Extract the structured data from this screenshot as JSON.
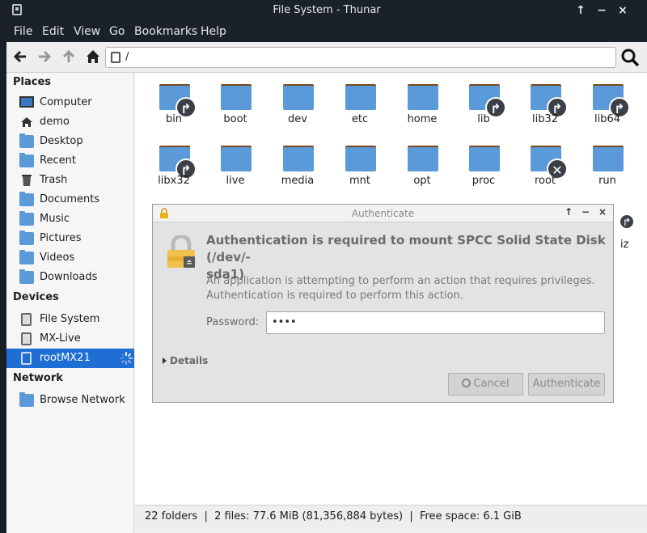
{
  "window": {
    "title": "File System - Thunar"
  },
  "titlebar_buttons": {
    "up": "↑",
    "minimize": "−",
    "close": "×"
  },
  "menu": [
    "File",
    "Edit",
    "View",
    "Go",
    "Bookmarks",
    "Help"
  ],
  "location": {
    "path": "/"
  },
  "sidebar": {
    "places_title": "Places",
    "places": [
      "Computer",
      "demo",
      "Desktop",
      "Recent",
      "Trash",
      "Documents",
      "Music",
      "Pictures",
      "Videos",
      "Downloads"
    ],
    "devices_title": "Devices",
    "devices": [
      "File System",
      "MX-Live",
      "rootMX21"
    ],
    "selected_device": "rootMX21",
    "network_title": "Network",
    "network": [
      "Browse Network"
    ]
  },
  "files": [
    {
      "name": "bin",
      "emblem": "link"
    },
    {
      "name": "boot",
      "emblem": ""
    },
    {
      "name": "dev",
      "emblem": ""
    },
    {
      "name": "etc",
      "emblem": ""
    },
    {
      "name": "home",
      "emblem": ""
    },
    {
      "name": "lib",
      "emblem": "link"
    },
    {
      "name": "lib32",
      "emblem": "link"
    },
    {
      "name": "lib64",
      "emblem": "link"
    },
    {
      "name": "libx32",
      "emblem": "link"
    },
    {
      "name": "live",
      "emblem": ""
    },
    {
      "name": "media",
      "emblem": ""
    },
    {
      "name": "mnt",
      "emblem": ""
    },
    {
      "name": "opt",
      "emblem": ""
    },
    {
      "name": "proc",
      "emblem": ""
    },
    {
      "name": "root",
      "emblem": "unreadable"
    },
    {
      "name": "run",
      "emblem": ""
    }
  ],
  "partial_label": "iz",
  "statusbar": {
    "text": "22 folders  |  2 files: 77.6 MiB (81,356,884 bytes)  |  Free space: 6.1 GiB"
  },
  "dialog": {
    "title": "Authenticate",
    "heading": "Authentication is required to mount SPCC Solid State Disk (/dev/-sda1)",
    "heading_line1": "Authentication is required to mount SPCC Solid State Disk (/dev/-",
    "heading_line2": "sda1)",
    "message_line1": "An application is attempting to perform an action that requires privileges.",
    "message_line2": "Authentication is required to perform this action.",
    "password_label": "Password:",
    "password_value": "••••",
    "details_label": "Details",
    "cancel_label": "Cancel",
    "authenticate_label": "Authenticate"
  },
  "colors": {
    "titlebar": "#1b2129",
    "selection": "#1f6ed4",
    "folder": "#5b9ad9",
    "folder_tab": "#7a4a1d"
  }
}
